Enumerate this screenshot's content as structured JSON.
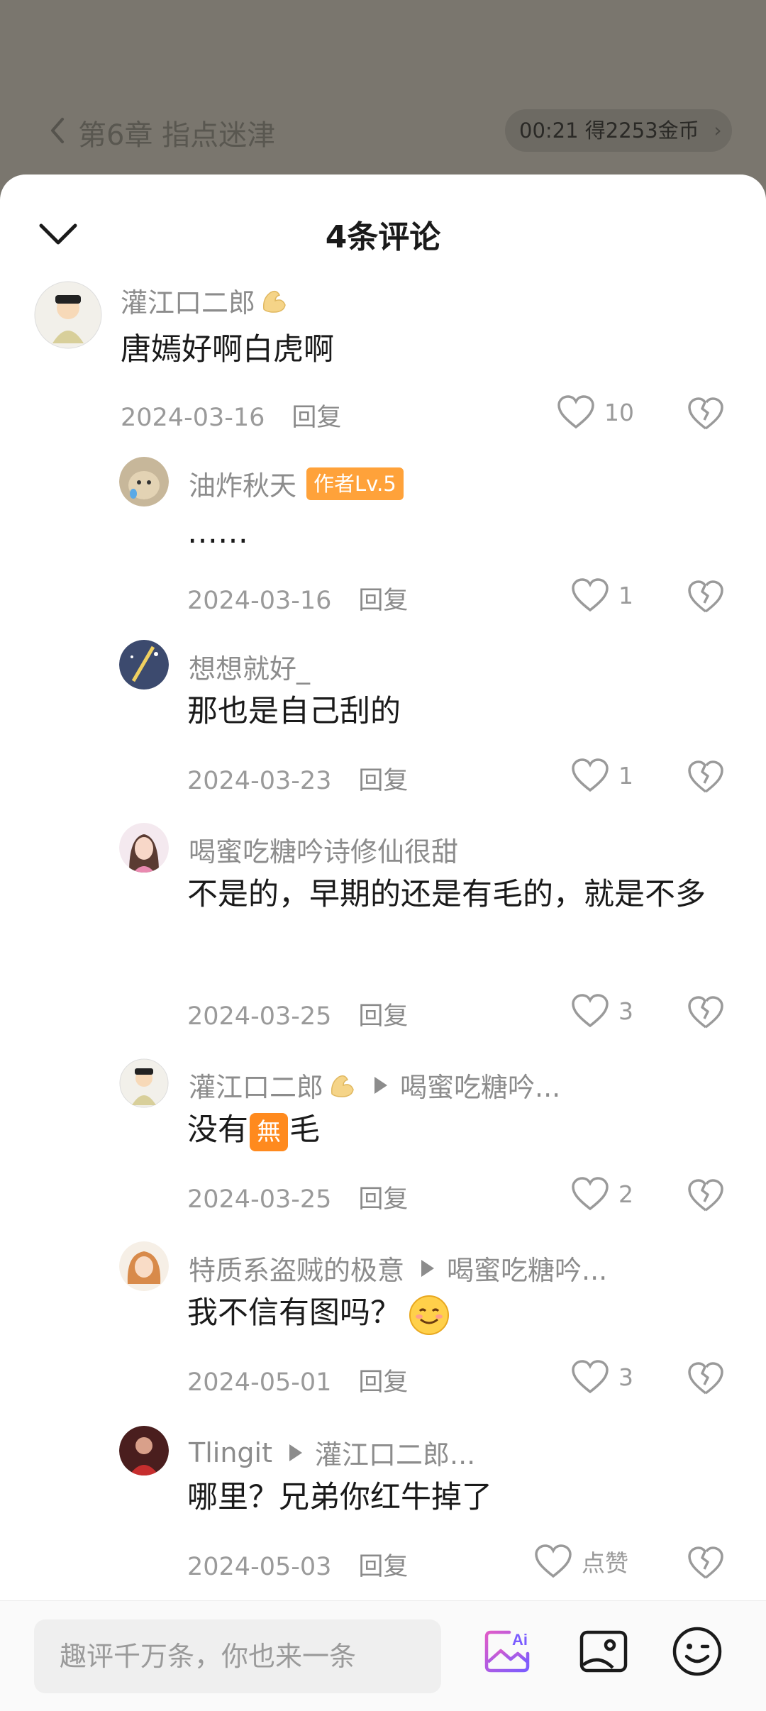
{
  "reader": {
    "chapter_title": "第6章 指点迷津",
    "coin_text": "00:21 得2253金币"
  },
  "sheet": {
    "title": "4条评论"
  },
  "comments": [
    {
      "name": "灌江口二郎",
      "content": "唐嫣好啊白虎啊",
      "date": "2024-03-16",
      "reply_label": "回复",
      "likes": "10"
    },
    {
      "name": "油炸秋天",
      "badge": "作者Lv.5",
      "content": "……",
      "date": "2024-03-16",
      "reply_label": "回复",
      "likes": "1"
    },
    {
      "name": "想想就好_",
      "content": "那也是自己刮的",
      "date": "2024-03-23",
      "reply_label": "回复",
      "likes": "1"
    },
    {
      "name": "喝蜜吃糖吟诗修仙很甜",
      "content": "不是的，早期的还是有毛的，就是不多",
      "date": "2024-03-25",
      "reply_label": "回复",
      "likes": "3"
    },
    {
      "name": "灌江口二郎",
      "reply_to": "喝蜜吃糖吟...",
      "content_before": "没有",
      "content_after": "毛",
      "emoji_text": "無",
      "date": "2024-03-25",
      "reply_label": "回复",
      "likes": "2"
    },
    {
      "name": "特质系盗贼的极意",
      "reply_to": "喝蜜吃糖吟...",
      "content": "我不信有图吗？",
      "date": "2024-05-01",
      "reply_label": "回复",
      "likes": "3"
    },
    {
      "name": "Tlingit",
      "reply_to": "灌江口二郎...",
      "content": "哪里？兄弟你红牛掉了",
      "date": "2024-05-03",
      "reply_label": "回复",
      "likes": "点赞"
    }
  ],
  "bottom_bar": {
    "input_placeholder": "趣评千万条，你也来一条",
    "ai_icon_text": "Ai"
  },
  "colors": {
    "badge": "#ffa23a",
    "muted_text": "#8c8c8c",
    "ai_gradient_start": "#e05cc8",
    "ai_gradient_end": "#7a5cff"
  }
}
